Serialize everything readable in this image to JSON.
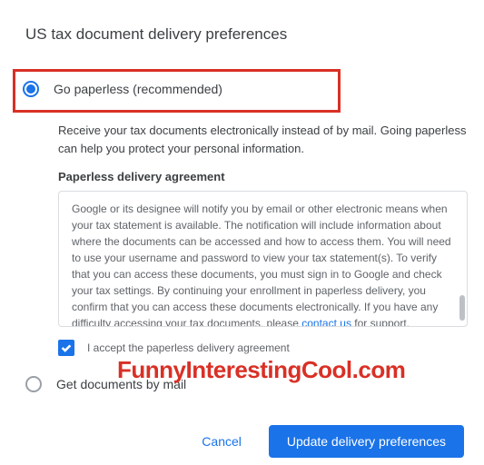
{
  "title": "US tax document delivery preferences",
  "options": {
    "paperless": {
      "label": "Go paperless (recommended)",
      "selected": true,
      "description": "Receive your tax documents electronically instead of by mail. Going paperless can help you protect your personal information.",
      "agreement_heading": "Paperless delivery agreement",
      "agreement_text": "Google or its designee will notify you by email or other electronic means when your tax statement is available. The notification will include information about where the documents can be accessed and how to access them. You will need to use your username and password to view your tax statement(s). To verify that you can access these documents, you must sign in to Google and check your tax settings. By continuing your enrollment in paperless delivery, you confirm that you can access these documents electronically. If you have any difficulty accessing your tax documents, please ",
      "agreement_link": "contact us",
      "agreement_suffix": " for support.",
      "accept_label": "I accept the paperless delivery agreement",
      "accept_checked": true
    },
    "mail": {
      "label": "Get documents by mail",
      "selected": false
    }
  },
  "actions": {
    "cancel": "Cancel",
    "update": "Update delivery preferences"
  },
  "watermark": "FunnyInterestingCool.com"
}
